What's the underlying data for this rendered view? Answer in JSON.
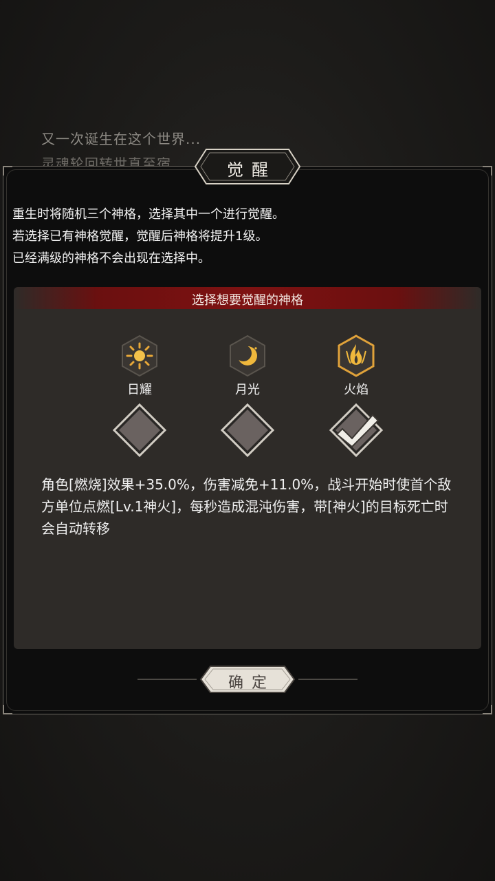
{
  "background": {
    "line1": "又一次诞生在这个世界...",
    "line2": "灵魂轮回转世真至宿"
  },
  "dialog": {
    "title": "觉醒",
    "description": [
      "重生时将随机三个神格，选择其中一个进行觉醒。",
      "若选择已有神格觉醒，觉醒后神格将提升1级。",
      "已经满级的神格不会出现在选择中。"
    ],
    "panel_header": "选择想要觉醒的神格",
    "deities": [
      {
        "label": "日耀",
        "icon": "sun-icon",
        "selected": false
      },
      {
        "label": "月光",
        "icon": "moon-icon",
        "selected": false
      },
      {
        "label": "火焰",
        "icon": "flame-icon",
        "selected": true
      }
    ],
    "effect_text": "角色[燃烧]效果+35.0%，伤害减免+11.0%，战斗开始时使首个敌方单位点燃[Lv.1神火]，每秒造成混沌伤害，带[神火]的目标死亡时会自动转移",
    "confirm_label": "确定"
  },
  "colors": {
    "accent_gold": "#d9a441",
    "header_red": "#7e1212",
    "panel_bg": "#2e2b28"
  }
}
